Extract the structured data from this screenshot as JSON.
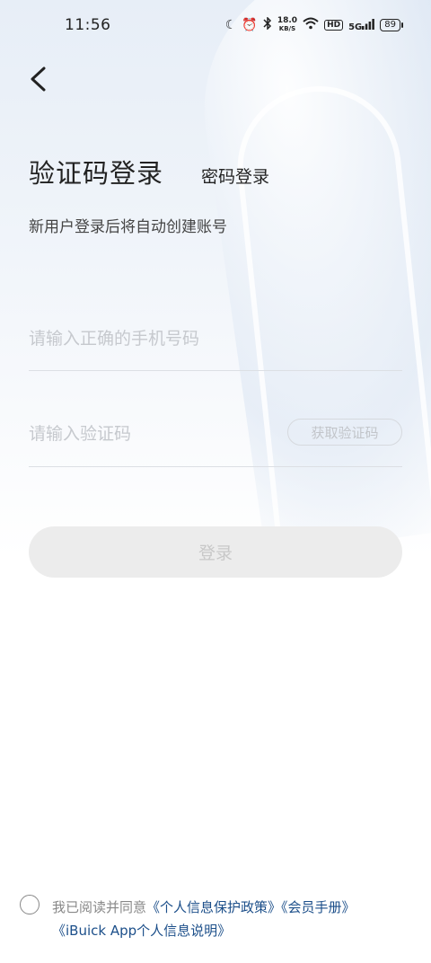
{
  "status_bar": {
    "time": "11:56",
    "net_speed_value": "18.0",
    "net_speed_unit": "KB/S",
    "hd_label": "HD",
    "signal_label": "5G",
    "battery": "89"
  },
  "icons": {
    "back": "chevron-left-icon",
    "moon": "moon-icon",
    "alarm": "alarm-icon",
    "bluetooth": "bluetooth-icon",
    "wifi": "wifi-icon"
  },
  "header": {
    "title": "验证码登录",
    "alt_login": "密码登录",
    "subtitle": "新用户登录后将自动创建账号"
  },
  "form": {
    "phone_placeholder": "请输入正确的手机号码",
    "phone_value": "",
    "code_placeholder": "请输入验证码",
    "code_value": "",
    "get_code_label": "获取验证码",
    "login_label": "登录"
  },
  "agreement": {
    "prefix": "我已阅读并同意",
    "privacy_policy": "《个人信息保护政策》",
    "member_handbook": "《会员手册》",
    "app_info": "《iBuick App个人信息说明》",
    "checked": false
  },
  "colors": {
    "link": "#1c4f8a",
    "button_disabled_bg": "#ececec",
    "button_disabled_text": "#c8c8c8"
  }
}
